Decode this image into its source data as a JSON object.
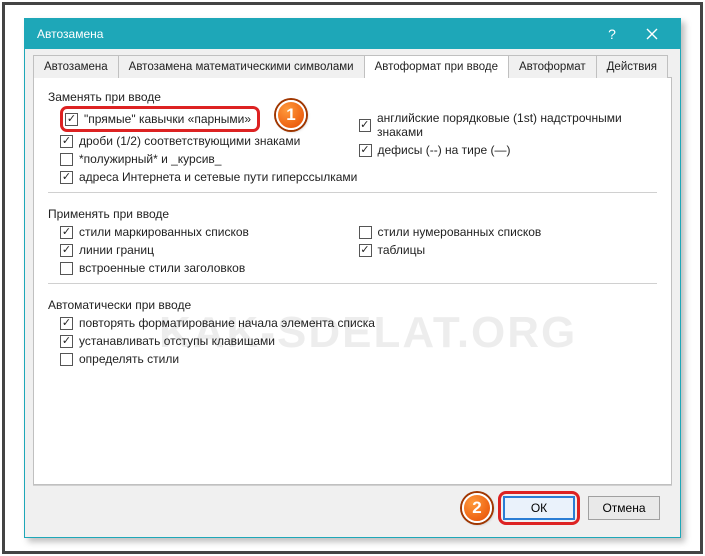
{
  "window": {
    "title": "Автозамена"
  },
  "tabs": [
    {
      "label": "Автозамена"
    },
    {
      "label": "Автозамена математическими символами"
    },
    {
      "label": "Автоформат при вводе"
    },
    {
      "label": "Автоформат"
    },
    {
      "label": "Действия"
    }
  ],
  "activeTab": 2,
  "groups": {
    "replace": {
      "title": "Заменять при вводе",
      "left": [
        {
          "label": "\"прямые\" кавычки «парными»",
          "checked": true,
          "highlighted": true
        },
        {
          "label": "дроби (1/2) соответствующими знаками",
          "checked": true
        },
        {
          "label": "*полужирный* и _курсив_",
          "checked": false
        },
        {
          "label": "адреса Интернета и сетевые пути гиперссылками",
          "checked": true
        }
      ],
      "right": [
        {
          "label": "английские порядковые (1st) надстрочными знаками",
          "checked": true
        },
        {
          "label": "дефисы (--) на тире (—)",
          "checked": true
        }
      ]
    },
    "apply": {
      "title": "Применять при вводе",
      "left": [
        {
          "label": "стили маркированных списков",
          "checked": true
        },
        {
          "label": "линии границ",
          "checked": true
        },
        {
          "label": "встроенные стили заголовков",
          "checked": false
        }
      ],
      "right": [
        {
          "label": "стили нумерованных списков",
          "checked": false
        },
        {
          "label": "таблицы",
          "checked": true
        }
      ]
    },
    "auto": {
      "title": "Автоматически при вводе",
      "items": [
        {
          "label": "повторять форматирование начала элемента списка",
          "checked": true
        },
        {
          "label": "устанавливать отступы клавишами",
          "checked": true
        },
        {
          "label": "определять стили",
          "checked": false
        }
      ]
    }
  },
  "buttons": {
    "ok": "ОК",
    "cancel": "Отмена"
  },
  "badges": {
    "one": "1",
    "two": "2"
  },
  "watermark": "KAK-SDELAT.ORG"
}
